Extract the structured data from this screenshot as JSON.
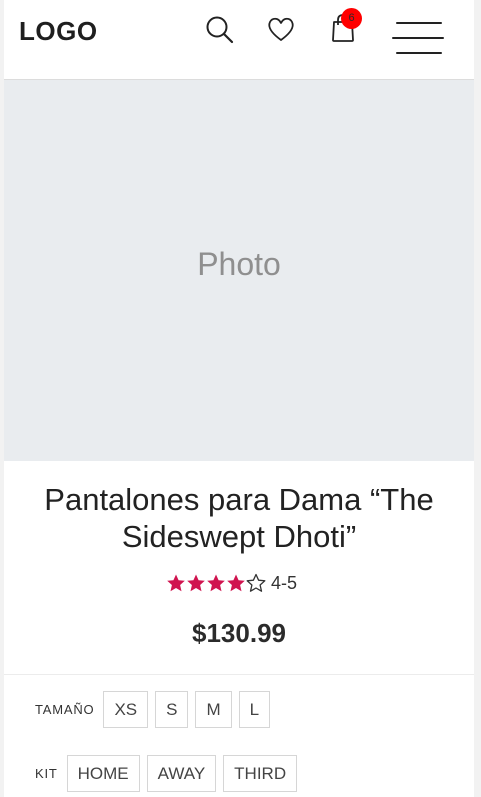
{
  "header": {
    "logo": "LOGO",
    "cart_count": "6"
  },
  "photo": {
    "label": "Photo"
  },
  "product": {
    "title": "Pantalones para Dama “The Sideswept Dhoti”",
    "rating_value": 4,
    "rating_max": 5,
    "rating_text": "4-5",
    "price": "$130.99"
  },
  "options": {
    "size": {
      "label": "TAMAÑO",
      "values": [
        "XS",
        "S",
        "M",
        "L"
      ]
    },
    "kit": {
      "label": "KIT",
      "values": [
        "HOME",
        "AWAY",
        "THIRD"
      ]
    }
  },
  "colors": {
    "star": "#d0144f",
    "badge": "#ff0000",
    "photo_bg": "#e9ecef"
  },
  "icons": [
    "search-icon",
    "heart-icon",
    "shopping-bag-icon",
    "hamburger-menu-icon",
    "star-filled-icon",
    "star-outline-icon"
  ]
}
